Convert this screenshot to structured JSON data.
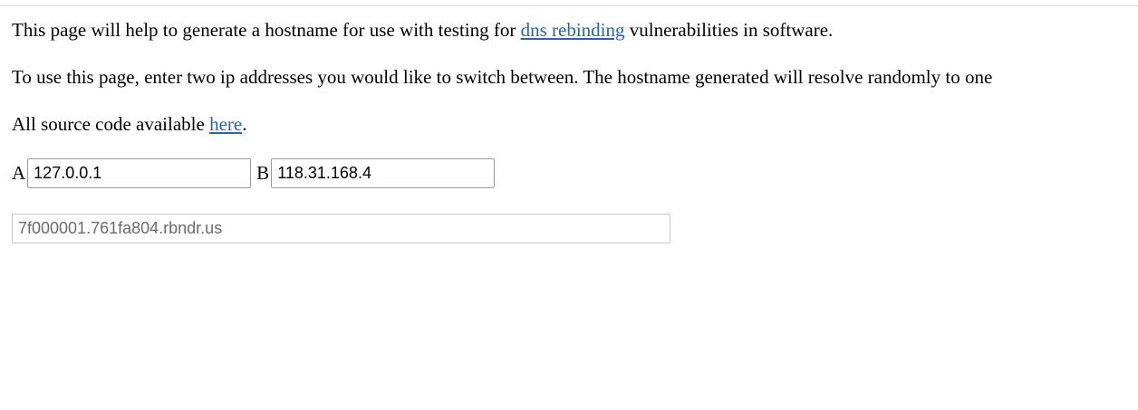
{
  "intro": {
    "before_link": "This page will help to generate a hostname for use with testing for ",
    "link_text": "dns rebinding",
    "after_link": " vulnerabilities in software."
  },
  "usage": {
    "text": "To use this page, enter two ip addresses you would like to switch between. The hostname generated will resolve randomly to one"
  },
  "source": {
    "before_link": "All source code available ",
    "link_text": "here",
    "after_link": "."
  },
  "form": {
    "label_a": "A",
    "value_a": "127.0.0.1",
    "label_b": "B",
    "value_b": "118.31.168.4",
    "hostname": "7f000001.761fa804.rbndr.us"
  },
  "colors": {
    "link": "#2266bb",
    "output_text": "#6b6b6b"
  }
}
